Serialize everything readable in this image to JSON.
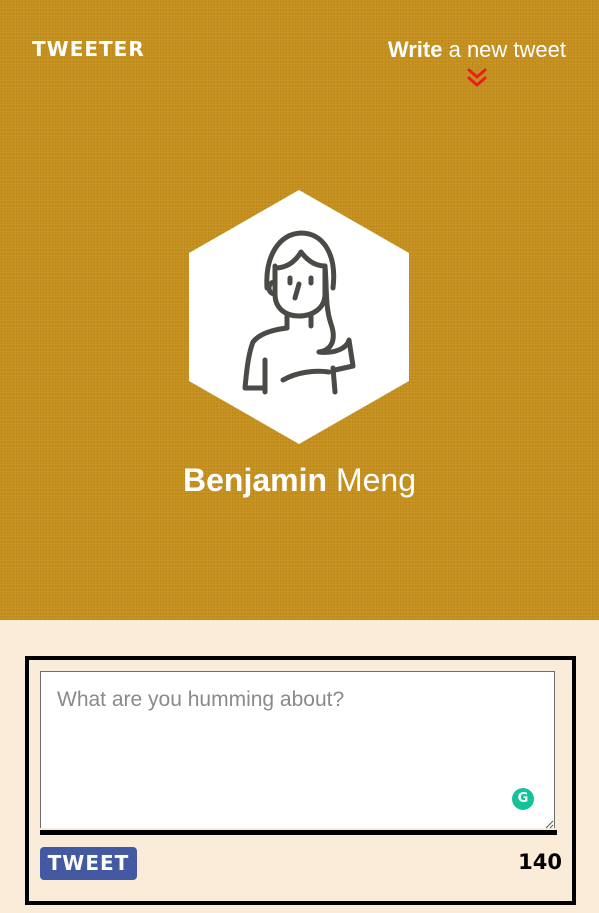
{
  "header": {
    "logo": "TWEETER",
    "compose_link": {
      "bold": "Write",
      "rest": " a new tweet",
      "arrow_icon": "double-chevron-down-icon"
    }
  },
  "profile": {
    "first_name": "Benjamin",
    "last_name": " Meng",
    "avatar_icon": "person-avatar-icon"
  },
  "composer": {
    "placeholder": "What are you humming about?",
    "value": "",
    "button_label": "TWEET",
    "counter": "140",
    "grammarly_icon": "G"
  },
  "colors": {
    "header_bg": "#c8921f",
    "page_bg": "#fbebd9",
    "button_bg": "#4359a1",
    "chevron": "#e8201b",
    "grammarly": "#15c39a"
  }
}
